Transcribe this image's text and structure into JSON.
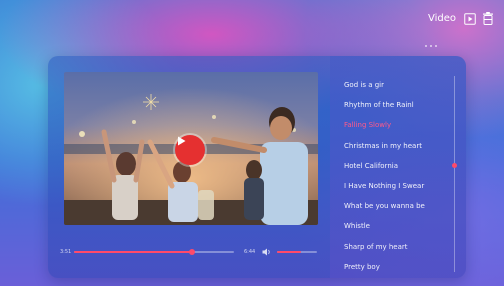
{
  "header": {
    "title": "Video",
    "icons": [
      "play-square-icon",
      "trash-icon"
    ]
  },
  "player": {
    "current_time": "3:51",
    "total_time": "6:44",
    "progress": 0.74,
    "volume": 0.6,
    "play_icon": "play-icon"
  },
  "playlist": {
    "active_index": 2,
    "items": [
      {
        "title": "God is a gir"
      },
      {
        "title": "Rhythm of the Rainl"
      },
      {
        "title": "Falling Slowly"
      },
      {
        "title": "Christmas in my heart"
      },
      {
        "title": "Hotel California"
      },
      {
        "title": "I Have Nothing I Swear"
      },
      {
        "title": "What be you wanna be"
      },
      {
        "title": "Whistle"
      },
      {
        "title": "Sharp of my heart"
      },
      {
        "title": "Pretty boy"
      }
    ]
  },
  "colors": {
    "accent": "#ff4a6a",
    "active_text": "#ff5a8a",
    "play_button": "#e53030"
  }
}
